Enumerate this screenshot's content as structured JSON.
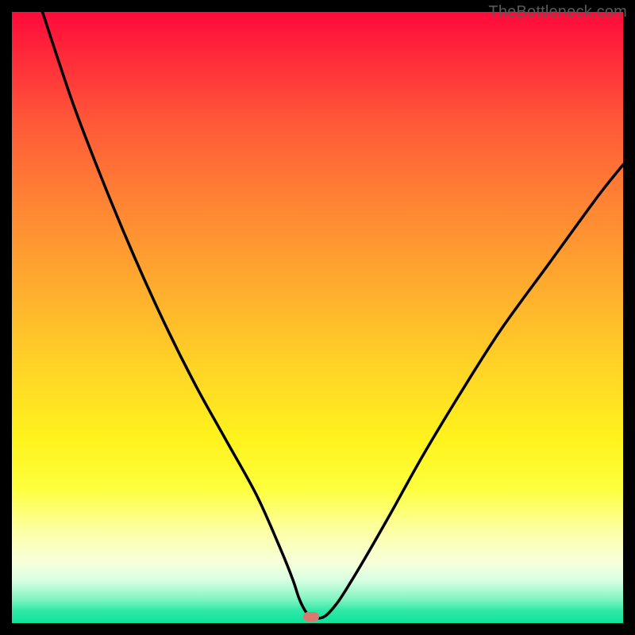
{
  "watermark": {
    "text": "TheBottleneck.com"
  },
  "marker": {
    "color": "#d87a70",
    "x_pct": 49,
    "y_pct": 99
  },
  "chart_data": {
    "type": "line",
    "title": "",
    "xlabel": "",
    "ylabel": "",
    "xlim": [
      0,
      100
    ],
    "ylim": [
      0,
      100
    ],
    "grid": false,
    "legend": false,
    "background": "red-yellow-green vertical gradient (high=red top, low=green bottom)",
    "annotations": [
      {
        "type": "marker",
        "x": 49,
        "y": 1,
        "shape": "pill",
        "color": "#d87a70"
      }
    ],
    "series": [
      {
        "name": "bottleneck-curve",
        "color": "#000000",
        "x": [
          5,
          10,
          15,
          20,
          25,
          30,
          35,
          40,
          44,
          46,
          47,
          48,
          49,
          51,
          53,
          55,
          58,
          62,
          67,
          73,
          80,
          88,
          96,
          100
        ],
        "y": [
          100,
          85,
          72,
          60,
          49,
          39,
          30,
          21,
          12,
          7,
          4,
          2,
          1,
          1,
          3,
          6,
          11,
          18,
          27,
          37,
          48,
          59,
          70,
          75
        ]
      }
    ]
  }
}
